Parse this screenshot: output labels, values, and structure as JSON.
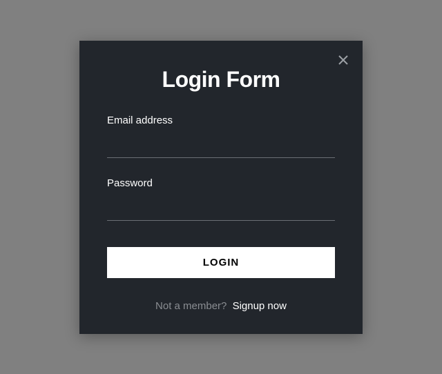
{
  "modal": {
    "title": "Login Form",
    "fields": {
      "email": {
        "label": "Email address",
        "value": ""
      },
      "password": {
        "label": "Password",
        "value": ""
      }
    },
    "login_button": "LOGIN",
    "footer": {
      "prompt": "Not a member?",
      "link": "Signup now"
    }
  }
}
